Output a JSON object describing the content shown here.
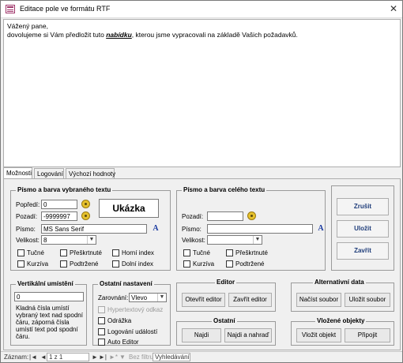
{
  "window": {
    "title": "Editace pole ve formátu RTF"
  },
  "editor": {
    "line1": "Vážený pane,",
    "line2_pre": "dovolujeme si Vám předložit tuto ",
    "line2_bold": "nabídku",
    "line2_post": ", kterou jsme vypracovali na základě Vašich požadavků."
  },
  "tabs": [
    {
      "label": "Možnosti"
    },
    {
      "label": "Logování"
    },
    {
      "label": "Výchozí hodnoty"
    }
  ],
  "sel_font": {
    "title": "Písmo a barva vybraného textu",
    "fg_label": "Popředí:",
    "fg_value": "0",
    "bg_label": "Pozadí:",
    "bg_value": "-9999997",
    "preview": "Ukázka",
    "font_label": "Písmo:",
    "font_value": "MS Sans Serif",
    "size_label": "Velikost:",
    "size_value": "8",
    "bold": "Tučné",
    "strike": "Přeškrtnuté",
    "super": "Horní index",
    "italic": "Kurzíva",
    "underline": "Podtržené",
    "sub": "Dolní index"
  },
  "all_font": {
    "title": "Písmo a barva celého textu",
    "bg_label": "Pozadí:",
    "bg_value": "",
    "font_label": "Písmo:",
    "font_value": "",
    "size_label": "Velikost:",
    "size_value": "",
    "bold": "Tučné",
    "strike": "Přeškrtnuté",
    "italic": "Kurzíva",
    "underline": "Podtržené"
  },
  "actions": {
    "cancel": "Zrušit",
    "save": "Uložit",
    "close": "Zavřít"
  },
  "vertical": {
    "title": "Vertikální umístění",
    "value": "0",
    "help": [
      "Kladná čísla umístí",
      "vybraný text nad spodní",
      "čáru, záporná čísla",
      "umístí text pod spodní",
      "čáru."
    ]
  },
  "other_settings": {
    "title": "Ostatní nastavení",
    "align_label": "Zarovnání:",
    "align_value": "Vlevo",
    "hyperlink": "Hypertextový odkaz",
    "bullet": "Odrážka",
    "log_events": "Logování událostí",
    "auto_editor": "Auto Editor"
  },
  "editor_grp": {
    "title": "Editor",
    "open": "Otevřít editor",
    "close": "Zavřít editor"
  },
  "alt_data": {
    "title": "Alternativní data",
    "load": "Načíst soubor",
    "save": "Uložit soubor"
  },
  "other_grp": {
    "title": "Ostatní",
    "find": "Najdi",
    "replace": "Najdi a nahraď"
  },
  "embedded": {
    "title": "Vložené objekty",
    "insert": "Vložit objekt",
    "attach": "Připojit"
  },
  "status": {
    "record_label": "Záznam:",
    "first": "|◄",
    "prev": "◄",
    "record_value": "1 z 1",
    "next": "►",
    "last": "►|",
    "new": "►*",
    "filter": "Bez filtru",
    "search": "Vyhledávání"
  }
}
